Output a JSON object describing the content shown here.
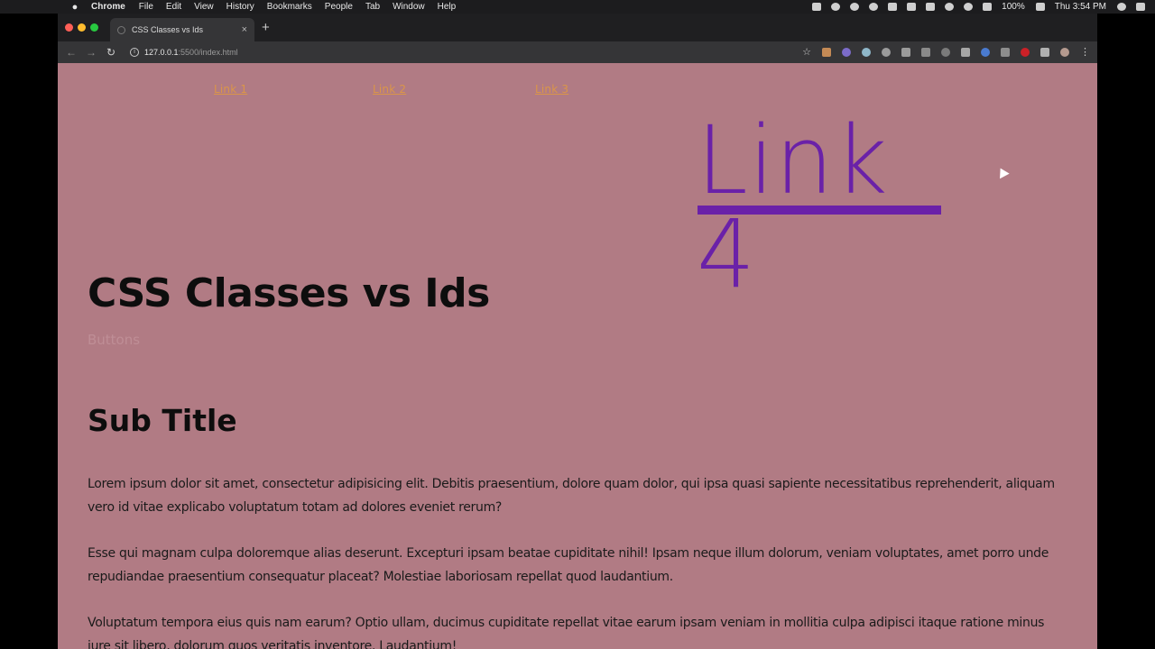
{
  "menubar": {
    "app_name": "Chrome",
    "items": [
      "File",
      "Edit",
      "View",
      "History",
      "Bookmarks",
      "People",
      "Tab",
      "Window",
      "Help"
    ],
    "battery": "100%",
    "clock": "Thu 3:54 PM"
  },
  "browser": {
    "tab_title": "CSS Classes vs Ids",
    "url_host": "127.0.0.1",
    "url_rest": ":5500/index.html"
  },
  "page": {
    "background": "#b17b84",
    "links": [
      "Link 1",
      "Link 2",
      "Link 3",
      "Link 4"
    ],
    "link_color": "#e29a3f",
    "link4_color": "#6a21a8",
    "title": "CSS Classes vs Ids",
    "faded_text": "Buttons",
    "sub_title": "Sub Title",
    "paragraphs": [
      "Lorem ipsum dolor sit amet, consectetur adipisicing elit. Debitis praesentium, dolore quam dolor, qui ipsa quasi sapiente necessitatibus reprehenderit, aliquam vero id vitae explicabo voluptatum totam ad dolores eveniet rerum?",
      "Esse qui magnam culpa doloremque alias deserunt. Excepturi ipsam beatae cupiditate nihil! Ipsam neque illum dolorum, veniam voluptates, amet porro unde repudiandae praesentium consequatur placeat? Molestiae laboriosam repellat quod laudantium.",
      "Voluptatum tempora eius quis nam earum? Optio ullam, ducimus cupiditate repellat vitae earum ipsam veniam in mollitia culpa adipisci itaque ratione minus iure sit libero, dolorum quos veritatis inventore. Laudantium!"
    ]
  }
}
